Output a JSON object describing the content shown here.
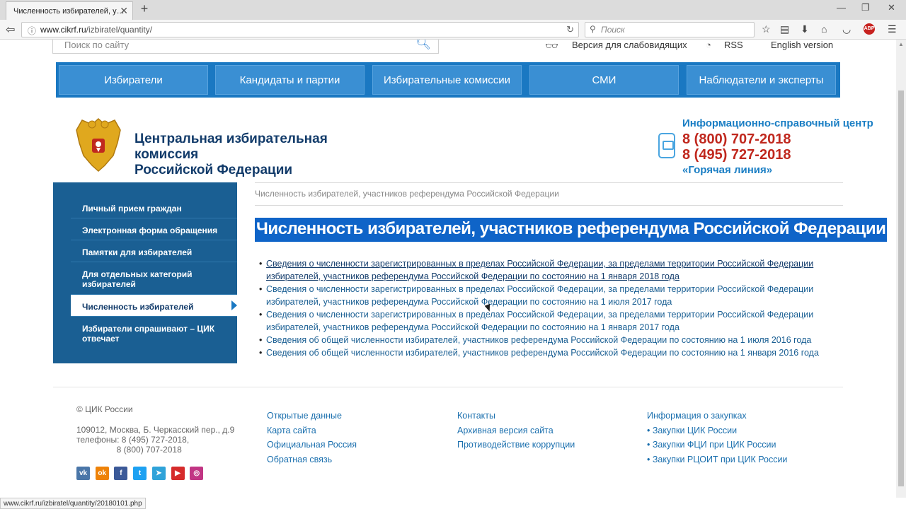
{
  "browser": {
    "tab_title": "Численность избирателей, у…",
    "new_tab": "+",
    "url_host": "www.cikrf.ru",
    "url_path": "/izbiratel/quantity/",
    "search_placeholder": "Поиск",
    "status_url": "www.cikrf.ru/izbiratel/quantity/20180101.php"
  },
  "header": {
    "site_search_placeholder": "Поиск по сайту",
    "accessibility_link": "Версия для слабовидящих",
    "rss_link": "RSS",
    "english_link": "English version"
  },
  "menu": [
    "Избиратели",
    "Кандидаты и партии",
    "Избирательные комиссии",
    "СМИ",
    "Наблюдатели и эксперты"
  ],
  "org": {
    "name_line1": "Центральная избирательная комиссия",
    "name_line2": "Российской Федерации"
  },
  "info": {
    "title": "Информационно-справочный центр",
    "phone1": "8 (800) 707-2018",
    "phone2": "8 (495) 727-2018",
    "hotline": "«Горячая линия»"
  },
  "sidebar": [
    {
      "label": "Личный прием граждан"
    },
    {
      "label": "Электронная форма обращения"
    },
    {
      "label": "Памятки для избирателей"
    },
    {
      "label": "Для отдельных категорий избирателей"
    },
    {
      "label": "Численность избирателей",
      "active": true
    },
    {
      "label": "Избиратели спрашивают – ЦИК отвечает"
    }
  ],
  "breadcrumb": "Численность избирателей, участников референдума Российской Федерации",
  "page_title": "Численность избирателей, участников референдума Российской Федерации",
  "documents": [
    "Сведения о численности зарегистрированных в пределах Российской Федерации, за пределами территории Российской Федерации избирателей, участников референдума Российской Федерации по состоянию на 1 января 2018 года",
    "Сведения о численности зарегистрированных в пределах Российской Федерации, за пределами территории Российской Федерации избирателей, участников референдума Российской Федерации по состоянию на 1 июля 2017 года",
    "Сведения о численности зарегистрированных в пределах Российской Федерации, за пределами территории Российской Федерации избирателей, участников референдума Российской Федерации по состоянию на 1 января 2017 года",
    "Сведения об общей численности избирателей, участников референдума Российской Федерации по состоянию на 1 июля 2016 года",
    "Сведения об общей численности избирателей, участников референдума Российской Федерации по состоянию на 1 января 2016 года"
  ],
  "footer": {
    "copyright": "© ЦИК России",
    "address": "109012, Москва, Б. Черкасский пер., д.9\nтелефоны: 8 (495) 727-2018,\n                 8 (800) 707-2018",
    "col1": [
      "Открытые данные",
      "Карта сайта",
      "Официальная Россия",
      "Обратная связь"
    ],
    "col2": [
      "Контакты",
      "Архивная версия сайта",
      "Противодействие коррупции"
    ],
    "col3_title": "Информация о закупках",
    "col3": [
      "Закупки ЦИК России",
      "Закупки ФЦИ при ЦИК России",
      "Закупки РЦОИТ при ЦИК России"
    ],
    "social": [
      {
        "icon": "vk-icon",
        "glyph": "vk",
        "color": "#4a76a8"
      },
      {
        "icon": "odnoklassniki-icon",
        "glyph": "ok",
        "color": "#ee8208"
      },
      {
        "icon": "facebook-icon",
        "glyph": "f",
        "color": "#3b5998"
      },
      {
        "icon": "twitter-icon",
        "glyph": "t",
        "color": "#1da1f2"
      },
      {
        "icon": "telegram-icon",
        "glyph": "➤",
        "color": "#2fa3d9"
      },
      {
        "icon": "youtube-icon",
        "glyph": "▶",
        "color": "#d62b2b"
      },
      {
        "icon": "instagram-icon",
        "glyph": "◎",
        "color": "#c13584"
      }
    ]
  },
  "colors": {
    "menu_bg": "#1a78c2",
    "sidebar_bg": "#1a5f93",
    "phone_red": "#c0281e",
    "title_highlight": "#0f64c8"
  }
}
